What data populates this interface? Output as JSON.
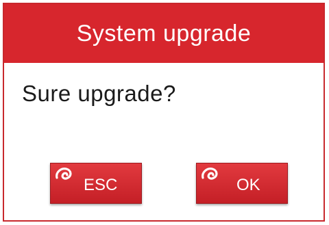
{
  "dialog": {
    "title": "System upgrade",
    "message": "Sure upgrade?",
    "accent_color": "#d7262d"
  },
  "buttons": {
    "esc": {
      "label": "ESC",
      "icon": "swirl-icon"
    },
    "ok": {
      "label": "OK",
      "icon": "swirl-icon"
    }
  }
}
